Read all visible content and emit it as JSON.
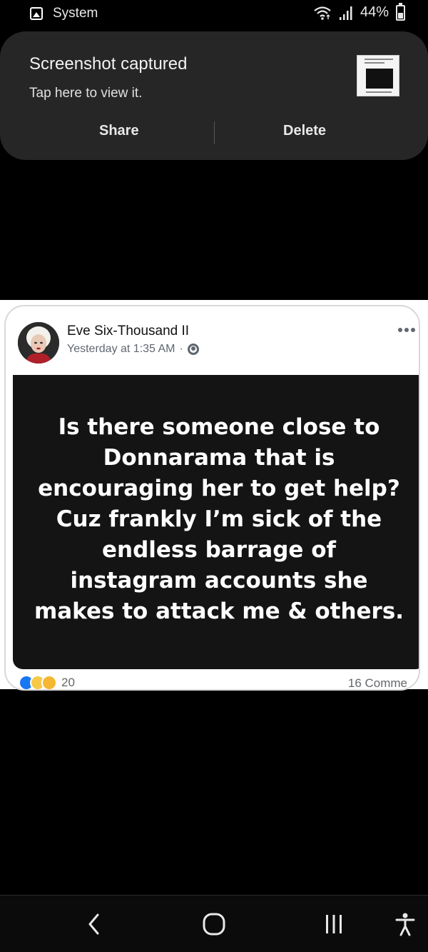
{
  "status_bar": {
    "app_name": "System",
    "battery_percent_text": "44%",
    "battery_level": 0.44,
    "icons": [
      "image-icon",
      "wifi-icon",
      "signal-icon",
      "battery-icon"
    ]
  },
  "notification": {
    "title": "Screenshot captured",
    "subtitle": "Tap here to view it.",
    "share_label": "Share",
    "delete_label": "Delete"
  },
  "post": {
    "poster_name": "Eve Six-Thousand II",
    "time": "Yesterday at 1:35 AM",
    "separator": "·",
    "text_lines": [
      "Is there someone close to",
      "Donnarama that is",
      "encouraging her to get help?",
      "Cuz frankly I’m sick of the",
      "endless barrage of",
      "instagram accounts she",
      "makes to attack me & others."
    ],
    "reaction_count": "20",
    "comments_label": "16 Comme",
    "colors": {
      "post_bg": "#141414",
      "meta_gray": "#606770",
      "like_blue": "#1877f2"
    }
  },
  "nav_bar": {
    "icons": [
      "back-icon",
      "home-icon",
      "recents-icon",
      "accessibility-icon"
    ]
  }
}
